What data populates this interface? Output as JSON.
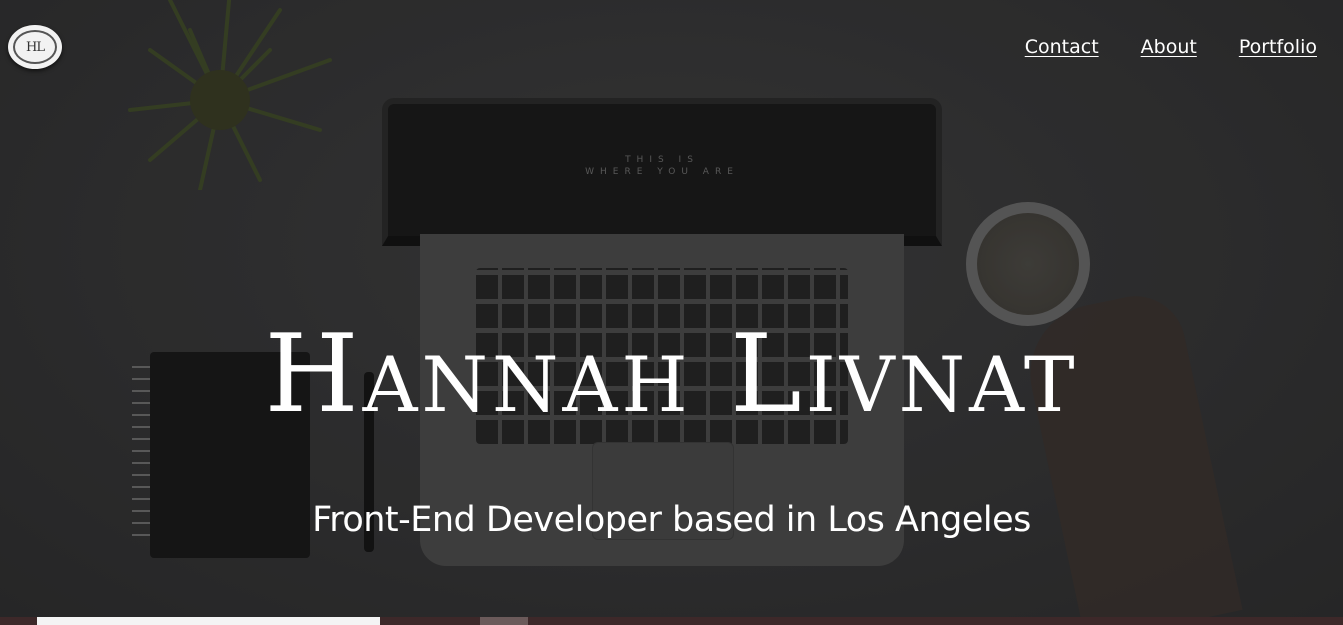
{
  "brand": {
    "logo_initials": "HL",
    "logo_icon": "hl-monogram-logo"
  },
  "nav": {
    "items": [
      {
        "label": "Contact"
      },
      {
        "label": "About"
      },
      {
        "label": "Portfolio"
      }
    ]
  },
  "hero": {
    "title": "Hannah Livnat",
    "subtitle": "Front-End Developer based in Los Angeles",
    "screen_line1": "THIS IS",
    "screen_line2": "WHERE YOU ARE"
  },
  "colors": {
    "background": "#323233",
    "text": "#ffffff",
    "taskbar": "#3d2829"
  }
}
